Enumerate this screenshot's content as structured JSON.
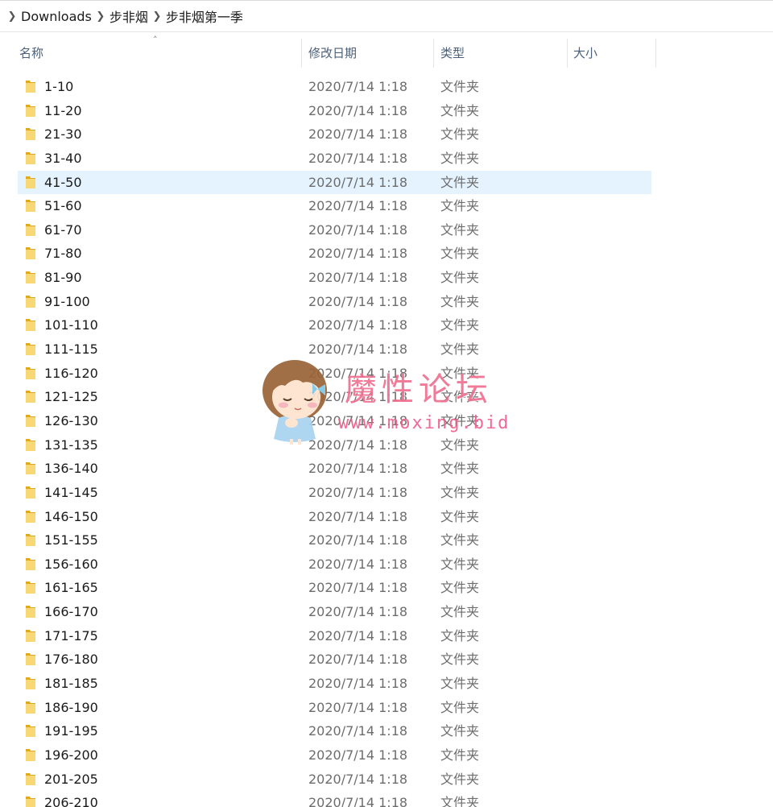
{
  "breadcrumb": {
    "items": [
      "Downloads",
      "步非烟",
      "步非烟第一季"
    ]
  },
  "columns": {
    "name": "名称",
    "modified": "修改日期",
    "type": "类型",
    "size": "大小"
  },
  "colors": {
    "folder_yellow": "#f8d775",
    "folder_dark": "#e0a91b",
    "selected_row": "#e5f3ff",
    "header_text": "#4c607a",
    "watermark_pink": "#ef6f8f"
  },
  "selected_index": 4,
  "rows": [
    {
      "name": "1-10",
      "date": "2020/7/14 1:18",
      "type": "文件夹",
      "size": ""
    },
    {
      "name": "11-20",
      "date": "2020/7/14 1:18",
      "type": "文件夹",
      "size": ""
    },
    {
      "name": "21-30",
      "date": "2020/7/14 1:18",
      "type": "文件夹",
      "size": ""
    },
    {
      "name": "31-40",
      "date": "2020/7/14 1:18",
      "type": "文件夹",
      "size": ""
    },
    {
      "name": "41-50",
      "date": "2020/7/14 1:18",
      "type": "文件夹",
      "size": ""
    },
    {
      "name": "51-60",
      "date": "2020/7/14 1:18",
      "type": "文件夹",
      "size": ""
    },
    {
      "name": "61-70",
      "date": "2020/7/14 1:18",
      "type": "文件夹",
      "size": ""
    },
    {
      "name": "71-80",
      "date": "2020/7/14 1:18",
      "type": "文件夹",
      "size": ""
    },
    {
      "name": "81-90",
      "date": "2020/7/14 1:18",
      "type": "文件夹",
      "size": ""
    },
    {
      "name": "91-100",
      "date": "2020/7/14 1:18",
      "type": "文件夹",
      "size": ""
    },
    {
      "name": "101-110",
      "date": "2020/7/14 1:18",
      "type": "文件夹",
      "size": ""
    },
    {
      "name": "111-115",
      "date": "2020/7/14 1:18",
      "type": "文件夹",
      "size": ""
    },
    {
      "name": "116-120",
      "date": "2020/7/14 1:18",
      "type": "文件夹",
      "size": ""
    },
    {
      "name": "121-125",
      "date": "2020/7/14 1:18",
      "type": "文件夹",
      "size": ""
    },
    {
      "name": "126-130",
      "date": "2020/7/14 1:18",
      "type": "文件夹",
      "size": ""
    },
    {
      "name": "131-135",
      "date": "2020/7/14 1:18",
      "type": "文件夹",
      "size": ""
    },
    {
      "name": "136-140",
      "date": "2020/7/14 1:18",
      "type": "文件夹",
      "size": ""
    },
    {
      "name": "141-145",
      "date": "2020/7/14 1:18",
      "type": "文件夹",
      "size": ""
    },
    {
      "name": "146-150",
      "date": "2020/7/14 1:18",
      "type": "文件夹",
      "size": ""
    },
    {
      "name": "151-155",
      "date": "2020/7/14 1:18",
      "type": "文件夹",
      "size": ""
    },
    {
      "name": "156-160",
      "date": "2020/7/14 1:18",
      "type": "文件夹",
      "size": ""
    },
    {
      "name": "161-165",
      "date": "2020/7/14 1:18",
      "type": "文件夹",
      "size": ""
    },
    {
      "name": "166-170",
      "date": "2020/7/14 1:18",
      "type": "文件夹",
      "size": ""
    },
    {
      "name": "171-175",
      "date": "2020/7/14 1:18",
      "type": "文件夹",
      "size": ""
    },
    {
      "name": "176-180",
      "date": "2020/7/14 1:18",
      "type": "文件夹",
      "size": ""
    },
    {
      "name": "181-185",
      "date": "2020/7/14 1:18",
      "type": "文件夹",
      "size": ""
    },
    {
      "name": "186-190",
      "date": "2020/7/14 1:18",
      "type": "文件夹",
      "size": ""
    },
    {
      "name": "191-195",
      "date": "2020/7/14 1:18",
      "type": "文件夹",
      "size": ""
    },
    {
      "name": "196-200",
      "date": "2020/7/14 1:18",
      "type": "文件夹",
      "size": ""
    },
    {
      "name": "201-205",
      "date": "2020/7/14 1:18",
      "type": "文件夹",
      "size": ""
    },
    {
      "name": "206-210",
      "date": "2020/7/14 1:18",
      "type": "文件夹",
      "size": ""
    }
  ],
  "watermark": {
    "title": "魔性论坛",
    "url": "www.moxing.bid"
  }
}
